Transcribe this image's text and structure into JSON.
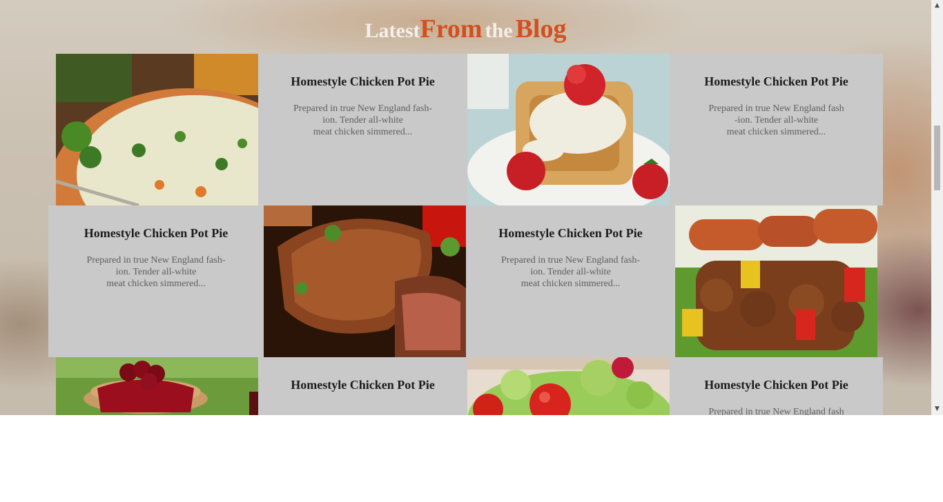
{
  "heading": {
    "part1": "Latest",
    "part2": "From",
    "part3": "the",
    "part4": "Blog"
  },
  "colors": {
    "accent": "#d1501e",
    "card_bg": "#c9c9c9",
    "title": "#1c1c1c",
    "excerpt": "#5e5e5e"
  },
  "cards": [
    {
      "title": "Homestyle Chicken Pot Pie",
      "lines": [
        "Prepared in true New England fash-",
        "ion. Tender all-white",
        "meat chicken simmered..."
      ]
    },
    {
      "title": "Homestyle Chicken Pot Pie",
      "lines": [
        "Prepared in true New England fash",
        "-ion. Tender all-white",
        "meat chicken simmered..."
      ]
    },
    {
      "title": "Homestyle Chicken Pot Pie",
      "lines": [
        "Prepared in true New England fash-",
        "ion. Tender all-white",
        "meat chicken simmered..."
      ]
    },
    {
      "title": "Homestyle Chicken Pot Pie",
      "lines": [
        "Prepared in true New England fash-",
        "ion. Tender all-white",
        "meat chicken simmered..."
      ]
    },
    {
      "title": "Homestyle Chicken Pot Pie",
      "lines": []
    },
    {
      "title": "Homestyle Chicken Pot Pie",
      "lines": [
        "Prepared in true New England fash"
      ]
    }
  ],
  "photos": [
    "chicken-soup-photo",
    "strawberry-waffles-photo",
    "grilled-steak-photo",
    "sausage-kebab-photo",
    "cherry-pancakes-photo",
    "salad-photo"
  ],
  "scrollbar": {
    "up_arrow": "▲",
    "down_arrow": "▼"
  }
}
